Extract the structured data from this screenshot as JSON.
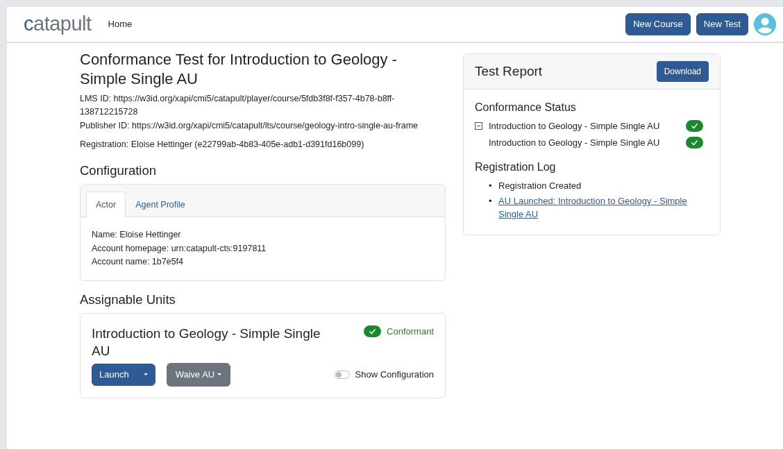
{
  "navbar": {
    "logo": "catapult",
    "links": [
      {
        "label": "Home"
      }
    ],
    "buttons": [
      "New Course",
      "New Test"
    ]
  },
  "test": {
    "title": "Conformance Test for Introduction to Geology - Simple Single AU",
    "details": [
      "LMS ID: https://w3id.org/xapi/cmi5/catapult/player/course/5fdb3f8f-f357-4b78-b8ff-138712215728",
      "Publisher ID: https://w3id.org/xapi/cmi5/catapult/lts/course/geology-intro-single-au-frame"
    ],
    "registration": "Registration: Eloise Hettinger (e22799ab-4b83-405e-adb1-d391fd16b099)"
  },
  "configuration": {
    "heading": "Configuration",
    "tabs": [
      {
        "label": "Actor",
        "selected": true
      },
      {
        "label": "Agent Profile",
        "selected": false
      }
    ],
    "lines": [
      "Name: Eloise Hettinger",
      "Account homepage: urn:catapult-cts:9197811",
      "Account name: 1b7e5f4"
    ]
  },
  "assignable_units": {
    "heading": "Assignable Units",
    "items": [
      {
        "title": "Introduction to Geology - Simple Single AU",
        "conformant": true,
        "status": "Conformant",
        "launch": "Launch",
        "waive": "Waive AU",
        "toggle": {
          "label": "Show Configuration",
          "on": false
        }
      }
    ]
  },
  "report": {
    "title": "Test Report",
    "download": "Download",
    "status_heading": "Conformance Status",
    "tree": [
      {
        "label": "Introduction to Geology - Simple Single AU",
        "expanded": true,
        "passed": true,
        "children": [
          {
            "label": "Introduction to Geology - Simple Single AU",
            "passed": true
          }
        ]
      }
    ],
    "log_heading": "Registration Log",
    "log": [
      {
        "kind": "text",
        "bullet": "•",
        "label": "Registration Created"
      },
      {
        "kind": "link",
        "bullet": "•",
        "label": "AU Launched: Introduction to Geology - Simple Single AU"
      }
    ]
  }
}
